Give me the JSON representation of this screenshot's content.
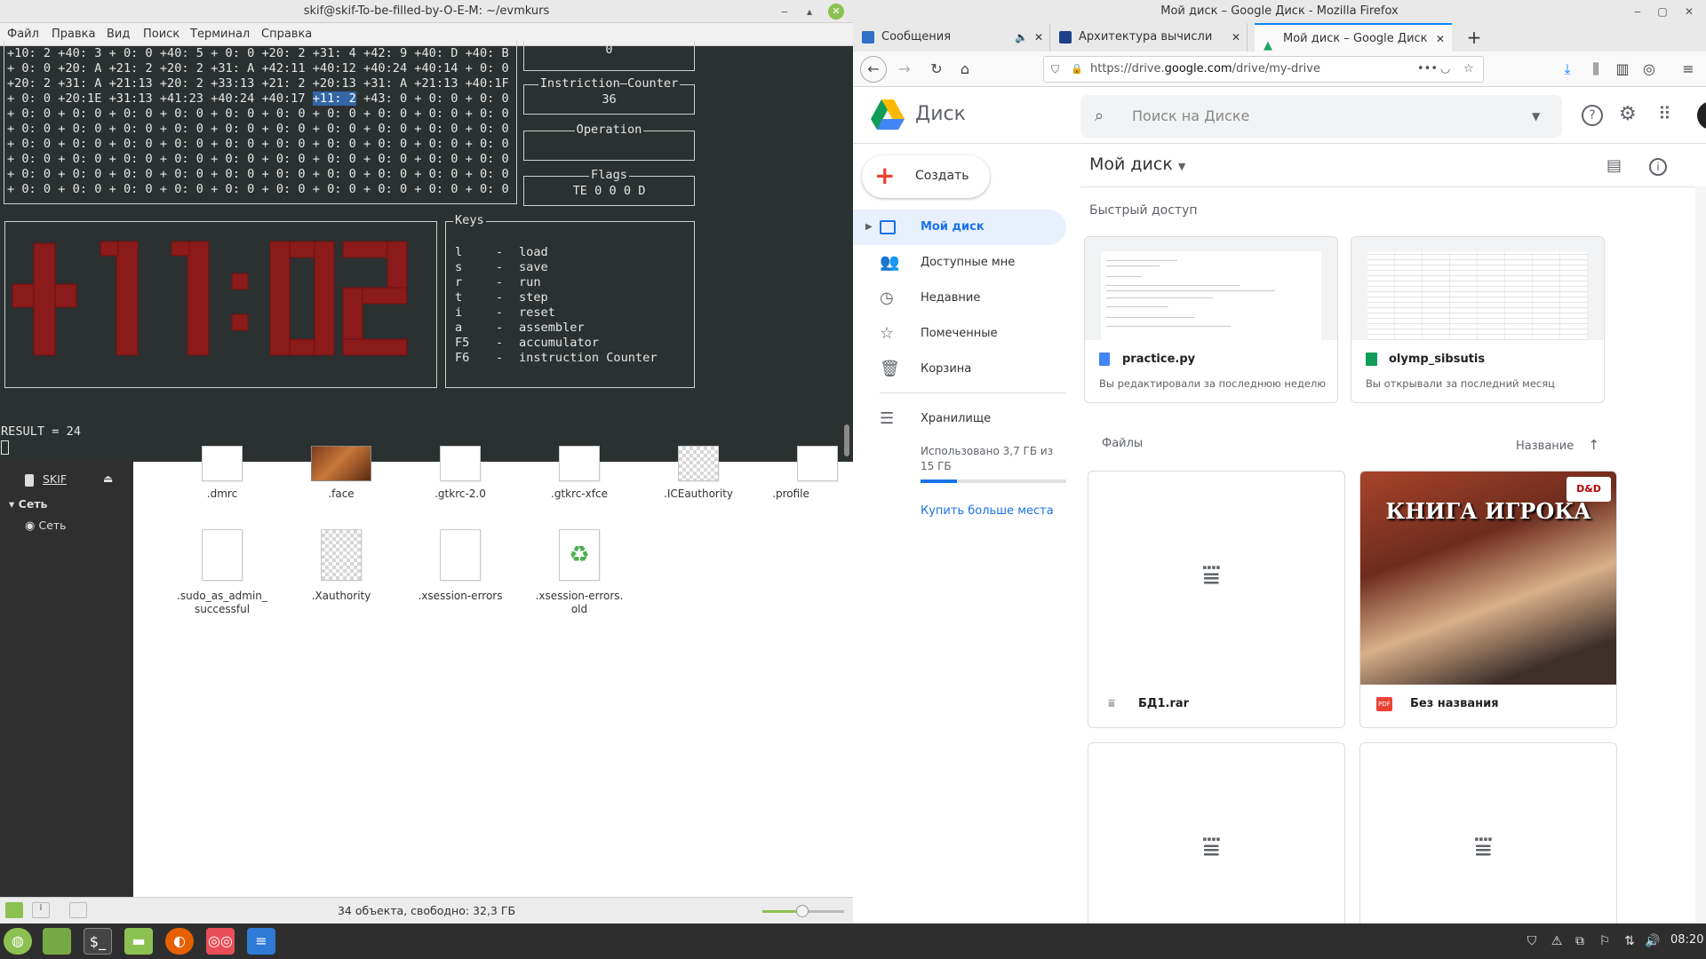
{
  "terminal": {
    "title": "skif@skif-To-be-filled-by-O-E-M: ~/evmkurs",
    "menu": [
      "Файл",
      "Правка",
      "Вид",
      "Поиск",
      "Терминал",
      "Справка"
    ],
    "memory_lines": [
      "+10: 2 +40: 3 + 0: 0 +40: 5 + 0: 0 +20: 2 +31: 4 +42: 9 +40: D +40: B",
      "+ 0: 0 +20: A +21: 2 +20: 2 +31: A +42:11 +40:12 +40:24 +40:14 + 0: 0",
      "+20: 2 +31: A +21:13 +20: 2 +33:13 +21: 2 +20:13 +31: A +21:13 +40:1F",
      "+ 0: 0 +20:1E +31:13 +41:23 +40:24 +40:17 +11: 2 +43: 0 + 0: 0 + 0: 0",
      "+ 0: 0 + 0: 0 + 0: 0 + 0: 0 + 0: 0 + 0: 0 + 0: 0 + 0: 0 + 0: 0 + 0: 0",
      "+ 0: 0 + 0: 0 + 0: 0 + 0: 0 + 0: 0 + 0: 0 + 0: 0 + 0: 0 + 0: 0 + 0: 0",
      "+ 0: 0 + 0: 0 + 0: 0 + 0: 0 + 0: 0 + 0: 0 + 0: 0 + 0: 0 + 0: 0 + 0: 0",
      "+ 0: 0 + 0: 0 + 0: 0 + 0: 0 + 0: 0 + 0: 0 + 0: 0 + 0: 0 + 0: 0 + 0: 0",
      "+ 0: 0 + 0: 0 + 0: 0 + 0: 0 + 0: 0 + 0: 0 + 0: 0 + 0: 0 + 0: 0 + 0: 0",
      "+ 0: 0 + 0: 0 + 0: 0 + 0: 0 + 0: 0 + 0: 0 + 0: 0 + 0: 0 + 0: 0 + 0: 0"
    ],
    "line4_prefix": "+ 0: 0 +20:1E +31:13 +41:23 +40:24 +40:17 ",
    "line4_highlight": "+11: 2",
    "line4_suffix": " +43: 0 + 0: 0 + 0: 0",
    "accumulator_value": "0",
    "counter_label": "Instriction—Counter",
    "counter_value": "36",
    "operation_label": "Operation",
    "flags_label": "Flags",
    "flags_value": "TE 0 0 0 D",
    "big_display": "+11:02",
    "keys_label": "Keys",
    "keys": [
      {
        "key": "l",
        "action": "load"
      },
      {
        "key": "s",
        "action": "save"
      },
      {
        "key": "r",
        "action": "run"
      },
      {
        "key": "t",
        "action": "step"
      },
      {
        "key": "i",
        "action": "reset"
      },
      {
        "key": "a",
        "action": "assembler"
      },
      {
        "key": "F5",
        "action": "accumulator"
      },
      {
        "key": "F6",
        "action": "instruction Counter"
      }
    ],
    "result": "RESULT = 24",
    "colors": {
      "big_display": "#8b1a1a",
      "highlight": "#3465a4"
    }
  },
  "file_manager": {
    "sidebar": {
      "device": "SKIF",
      "network_header": "Сеть",
      "network_item": "Сеть"
    },
    "files": [
      {
        "name": ".dmrc",
        "kind": "text"
      },
      {
        "name": ".face",
        "kind": "image"
      },
      {
        "name": ".gtkrc-2.0",
        "kind": "text"
      },
      {
        "name": ".gtkrc-xfce",
        "kind": "text"
      },
      {
        "name": ".ICEauthority",
        "kind": "checker"
      },
      {
        "name": ".profile",
        "kind": "text"
      },
      {
        "name": ".sudo_as_admin_\nsuccessful",
        "kind": "text"
      },
      {
        "name": ".Xauthority",
        "kind": "checker"
      },
      {
        "name": ".xsession-errors",
        "kind": "text"
      },
      {
        "name": ".xsession-errors.\nold",
        "kind": "recycle"
      }
    ],
    "status": "34 объекта, свободно: 32,3 ГБ"
  },
  "firefox": {
    "window_title": "Мой диск – Google Диск - Mozilla Firefox",
    "tabs": [
      {
        "label": "Сообщения",
        "active": false
      },
      {
        "label": "Архитектура вычислите",
        "active": false
      },
      {
        "label": "Мой диск – Google Диск",
        "active": true
      }
    ],
    "url_prefix": "https://drive.",
    "url_host": "google.com",
    "url_path": "/drive/my-drive"
  },
  "drive": {
    "logo_text": "Диск",
    "search_placeholder": "Поиск на Диске",
    "create_label": "Создать",
    "nav": [
      {
        "label": "Мой диск",
        "icon": "my-drive-icon",
        "active": true
      },
      {
        "label": "Доступные мне",
        "icon": "shared-icon",
        "active": false
      },
      {
        "label": "Недавние",
        "icon": "clock-icon",
        "active": false
      },
      {
        "label": "Помеченные",
        "icon": "star-icon",
        "active": false
      },
      {
        "label": "Корзина",
        "icon": "trash-icon",
        "active": false
      }
    ],
    "storage_label": "Хранилище",
    "storage_used": "Использовано 3,7 ГБ из 15 ГБ",
    "storage_fraction": 0.25,
    "buy_more": "Купить больше места",
    "breadcrumb": "Мой диск",
    "quick_access_label": "Быстрый доступ",
    "quick_access": [
      {
        "name": "practice.py",
        "subtitle": "Вы редактировали за последнюю неделю",
        "icon": "doc-icon"
      },
      {
        "name": "olymp_sibsutis",
        "subtitle": "Вы открывали за последний месяц",
        "icon": "sheet-icon"
      }
    ],
    "files_label": "Файлы",
    "sort_label": "Название",
    "files": [
      {
        "name": "БД1.rar",
        "icon": "archive-icon"
      },
      {
        "name": "Без названия",
        "icon": "pdf-icon",
        "cover_title": "КНИГА ИГРОКА",
        "cover_logo": "D&D"
      },
      {
        "name": "",
        "icon": "archive-icon"
      },
      {
        "name": "",
        "icon": "archive-icon"
      }
    ],
    "colors": {
      "accent": "#1a73e8",
      "active_bg": "#e8f0fe"
    }
  },
  "taskbar": {
    "clock": "08:20"
  }
}
